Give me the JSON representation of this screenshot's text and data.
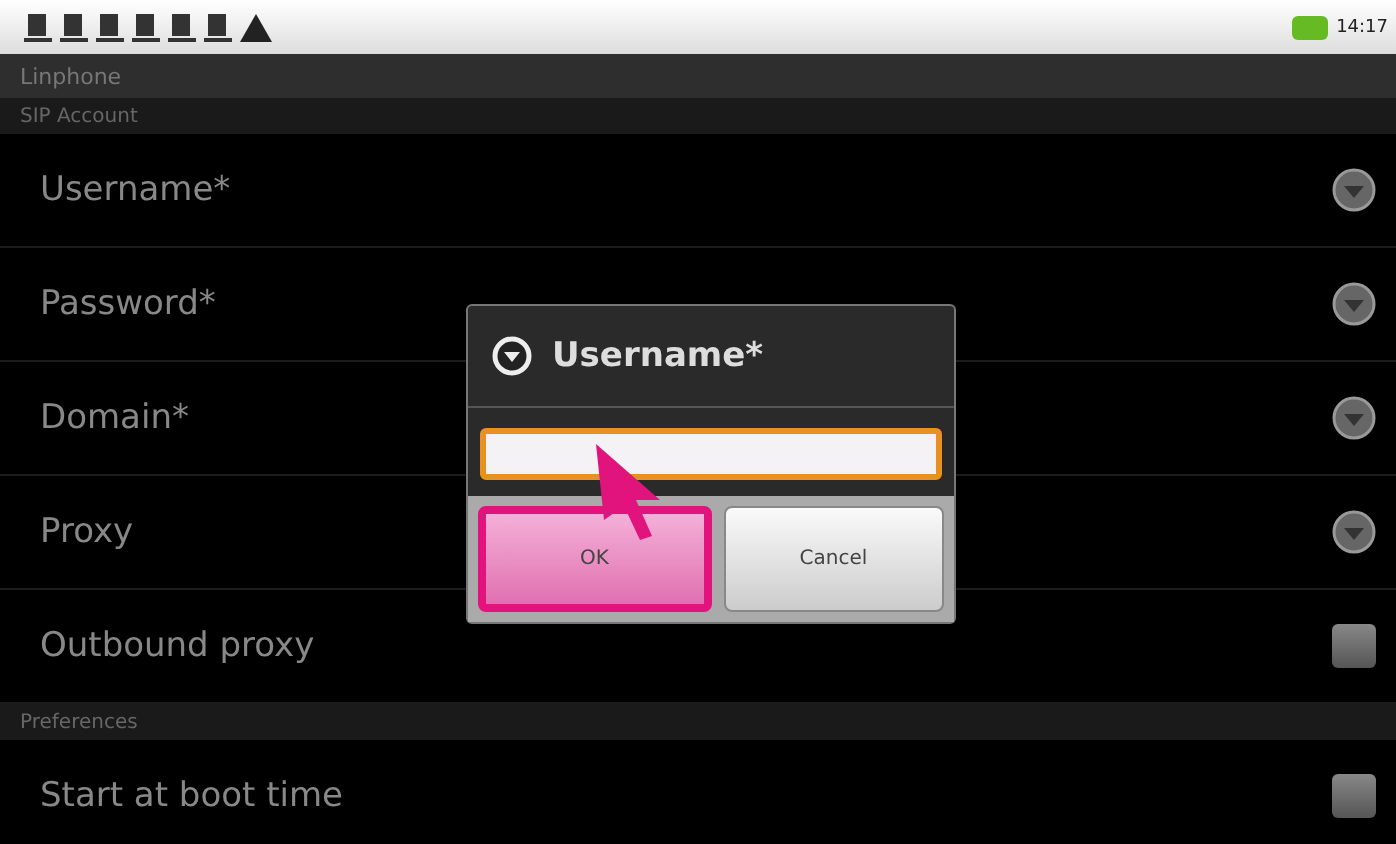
{
  "status_bar": {
    "time": "14:17"
  },
  "window": {
    "title": "Linphone"
  },
  "sections": [
    {
      "header": "SIP Account",
      "items": [
        {
          "kind": "edit",
          "label": "Username*"
        },
        {
          "kind": "edit",
          "label": "Password*"
        },
        {
          "kind": "edit",
          "label": "Domain*"
        },
        {
          "kind": "edit",
          "label": "Proxy"
        },
        {
          "kind": "checkbox",
          "label": "Outbound proxy",
          "checked": false
        }
      ]
    },
    {
      "header": "Preferences",
      "items": [
        {
          "kind": "checkbox",
          "label": "Start at boot time",
          "checked": false
        }
      ]
    }
  ],
  "dialog": {
    "title": "Username*",
    "buttons": [
      {
        "label": "OK",
        "highlighted": true
      },
      {
        "label": "Cancel",
        "highlighted": false
      }
    ]
  }
}
